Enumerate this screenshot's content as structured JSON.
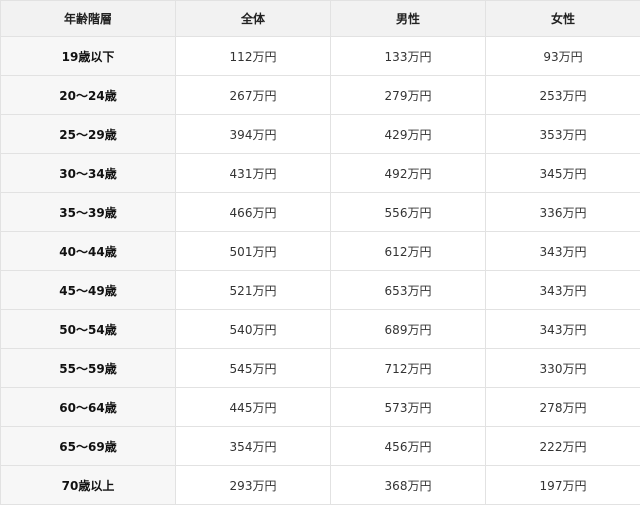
{
  "table": {
    "headers": [
      "年齢階層",
      "全体",
      "男性",
      "女性"
    ],
    "rows": [
      [
        "19歳以下",
        "112万円",
        "133万円",
        "93万円"
      ],
      [
        "20〜24歳",
        "267万円",
        "279万円",
        "253万円"
      ],
      [
        "25〜29歳",
        "394万円",
        "429万円",
        "353万円"
      ],
      [
        "30〜34歳",
        "431万円",
        "492万円",
        "345万円"
      ],
      [
        "35〜39歳",
        "466万円",
        "556万円",
        "336万円"
      ],
      [
        "40〜44歳",
        "501万円",
        "612万円",
        "343万円"
      ],
      [
        "45〜49歳",
        "521万円",
        "653万円",
        "343万円"
      ],
      [
        "50〜54歳",
        "540万円",
        "689万円",
        "343万円"
      ],
      [
        "55〜59歳",
        "545万円",
        "712万円",
        "330万円"
      ],
      [
        "60〜64歳",
        "445万円",
        "573万円",
        "278万円"
      ],
      [
        "65〜69歳",
        "354万円",
        "456万円",
        "222万円"
      ],
      [
        "70歳以上",
        "293万円",
        "368万円",
        "197万円"
      ]
    ]
  },
  "colors": {
    "header_bg": "#f2f2f2",
    "age_cell_bg": "#f7f7f7",
    "border": "#e2e2e2"
  }
}
